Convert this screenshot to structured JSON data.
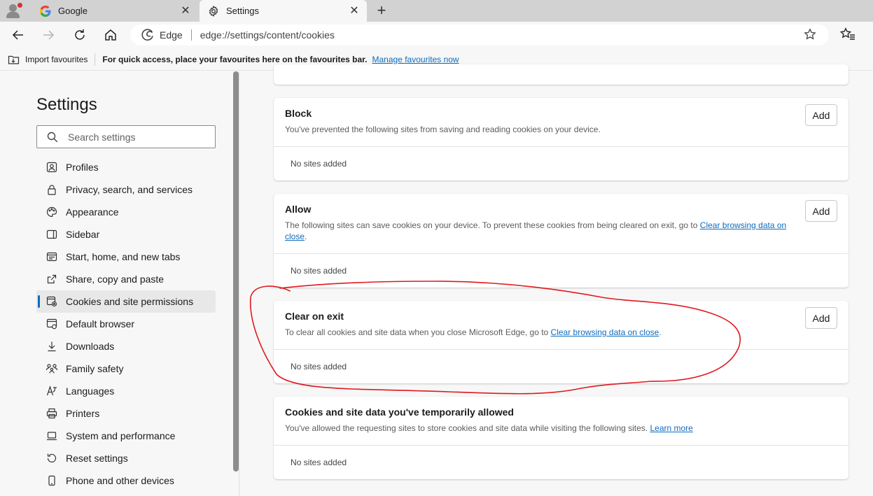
{
  "tabs": [
    {
      "title": "Google",
      "icon": "google-icon",
      "active": false
    },
    {
      "title": "Settings",
      "icon": "gear-icon",
      "active": true
    }
  ],
  "address": {
    "brand": "Edge",
    "url": "edge://settings/content/cookies"
  },
  "favbar": {
    "import_label": "Import favourites",
    "hint": "For quick access, place your favourites here on the favourites bar.",
    "manage_link": "Manage favourites now"
  },
  "sidebar": {
    "title": "Settings",
    "search_placeholder": "Search settings",
    "items": [
      {
        "label": "Profiles",
        "icon": "profile-icon"
      },
      {
        "label": "Privacy, search, and services",
        "icon": "lock-icon"
      },
      {
        "label": "Appearance",
        "icon": "palette-icon"
      },
      {
        "label": "Sidebar",
        "icon": "sidebar-icon"
      },
      {
        "label": "Start, home, and new tabs",
        "icon": "home-tabs-icon"
      },
      {
        "label": "Share, copy and paste",
        "icon": "share-icon"
      },
      {
        "label": "Cookies and site permissions",
        "icon": "cookies-icon",
        "active": true
      },
      {
        "label": "Default browser",
        "icon": "browser-icon"
      },
      {
        "label": "Downloads",
        "icon": "download-icon"
      },
      {
        "label": "Family safety",
        "icon": "family-icon"
      },
      {
        "label": "Languages",
        "icon": "language-icon"
      },
      {
        "label": "Printers",
        "icon": "printer-icon"
      },
      {
        "label": "System and performance",
        "icon": "laptop-icon"
      },
      {
        "label": "Reset settings",
        "icon": "reset-icon"
      },
      {
        "label": "Phone and other devices",
        "icon": "phone-icon"
      }
    ]
  },
  "cards": {
    "block": {
      "title": "Block",
      "desc": "You've prevented the following sites from saving and reading cookies on your device.",
      "add": "Add",
      "empty": "No sites added"
    },
    "allow": {
      "title": "Allow",
      "desc": "The following sites can save cookies on your device. To prevent these cookies from being cleared on exit, go to ",
      "link": "Clear browsing data on close",
      "desc_end": ".",
      "add": "Add",
      "empty": "No sites added"
    },
    "clear": {
      "title": "Clear on exit",
      "desc": "To clear all cookies and site data when you close Microsoft Edge, go to ",
      "link": "Clear browsing data on close",
      "desc_end": ".",
      "add": "Add",
      "empty": "No sites added"
    },
    "temp": {
      "title": "Cookies and site data you've temporarily allowed",
      "desc": "You've allowed the requesting sites to store cookies and site data while visiting the following sites. ",
      "link": "Learn more",
      "empty": "No sites added"
    }
  },
  "colors": {
    "accent": "#0f6cbd",
    "annotation": "#e0191f",
    "tabstrip": "#d2d2d2"
  }
}
